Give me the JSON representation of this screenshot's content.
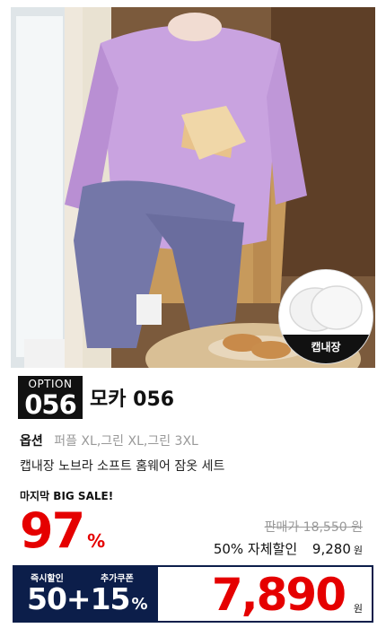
{
  "image": {
    "alt_badge": "캡내장"
  },
  "option": {
    "word": "OPTION",
    "number": "056"
  },
  "product": {
    "title": "모카 056",
    "option_label": "옵션",
    "option_values": "퍼플 XL,그린 XL,그린 3XL",
    "description": "캡내장 노브라 소프트 홈웨어 잠옷 세트"
  },
  "price": {
    "sale_label": "마지막 BIG SALE!",
    "discount_pct": "97",
    "pct_sign": "%",
    "original": "판매가 18,550 원",
    "self_discount_label": "50% 자체할인",
    "self_discount_price": "9,280",
    "currency": "원",
    "immediate_label": "즉시할인",
    "coupon_label": "추가쿠폰",
    "combo": "50+15",
    "final": "7,890"
  },
  "colors": {
    "accent_red": "#e50000",
    "navy": "#0c1e4a"
  }
}
